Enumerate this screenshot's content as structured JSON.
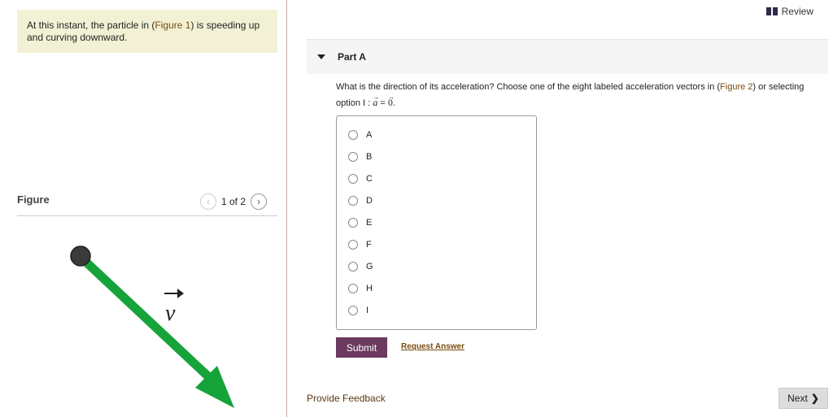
{
  "problem": {
    "text_before": "At this instant, the particle in (",
    "figure_link": "Figure 1",
    "text_after": ") is speeding up and curving downward."
  },
  "figure_panel": {
    "label": "Figure",
    "counter": "1 of 2",
    "prev_icon": "chevron-left-icon",
    "next_icon": "chevron-right-icon",
    "vector_label": "v",
    "arrow_color": "#16a33a",
    "particle_color": "#3a3a3a"
  },
  "header": {
    "review_label": "Review"
  },
  "part": {
    "title": "Part A",
    "question_before": "What is the direction of its acceleration? Choose one of the eight labeled acceleration vectors in (",
    "figure_link": "Figure 2",
    "question_after": ") or selecting option I : ",
    "eq_a": "a",
    "eq_mid": " = ",
    "eq_zero": "0",
    "eq_end": ".",
    "options": [
      "A",
      "B",
      "C",
      "D",
      "E",
      "F",
      "G",
      "H",
      "I"
    ],
    "submit_label": "Submit",
    "request_label": "Request Answer"
  },
  "footer": {
    "feedback_label": "Provide Feedback",
    "next_label": "Next"
  },
  "colors": {
    "submit_bg": "#6b3a5e",
    "problem_bg": "#f3f1d5",
    "link": "#7a4a10"
  }
}
